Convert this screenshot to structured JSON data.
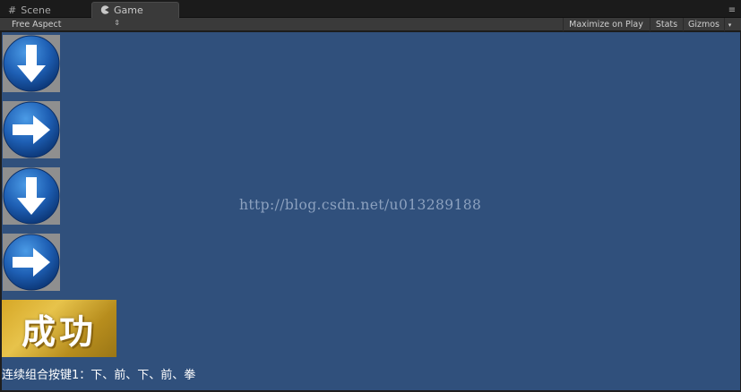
{
  "tabs": [
    {
      "label": "Scene",
      "icon": "grid-icon"
    },
    {
      "label": "Game",
      "icon": "pacman-icon"
    }
  ],
  "toolbar": {
    "aspect": "Free Aspect",
    "maximize_on_play": "Maximize on Play",
    "stats": "Stats",
    "gizmos": "Gizmos"
  },
  "game": {
    "arrows": [
      {
        "icon": "arrow-down-icon",
        "direction": "down"
      },
      {
        "icon": "arrow-right-icon",
        "direction": "right"
      },
      {
        "icon": "arrow-down-icon",
        "direction": "down"
      },
      {
        "icon": "arrow-right-icon",
        "direction": "right"
      }
    ],
    "success_label": "成功",
    "watermark": "http://blog.csdn.net/u013289188",
    "combo_line": "连续组合按键1：下、前、下、前、拳",
    "colors": {
      "background": "#30507c",
      "arrow_blue": "#1e5fb4",
      "gold": "#d6a726"
    }
  }
}
